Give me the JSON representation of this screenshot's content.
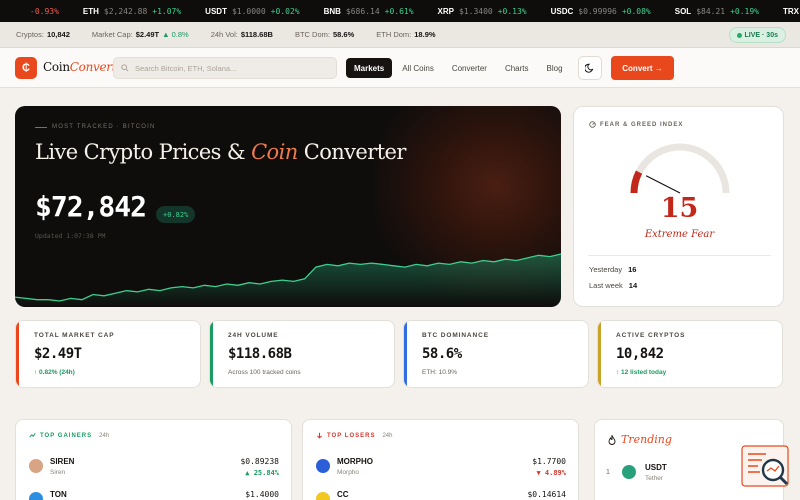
{
  "ticker": [
    {
      "sym": "",
      "price": "",
      "change": "-0.93%",
      "neg": true
    },
    {
      "sym": "ETH",
      "price": "$2,242.88",
      "change": "+1.07%",
      "neg": false
    },
    {
      "sym": "USDT",
      "price": "$1.0000",
      "change": "+0.02%",
      "neg": false
    },
    {
      "sym": "BNB",
      "price": "$686.14",
      "change": "+0.61%",
      "neg": false
    },
    {
      "sym": "XRP",
      "price": "$1.3400",
      "change": "+0.13%",
      "neg": false
    },
    {
      "sym": "USDC",
      "price": "$0.99996",
      "change": "+0.08%",
      "neg": false
    },
    {
      "sym": "SOL",
      "price": "$84.21",
      "change": "+0.19%",
      "neg": false
    },
    {
      "sym": "TRX",
      "price": "$0.31825",
      "change": "+0.28%",
      "neg": false
    }
  ],
  "stats": {
    "cryptos_label": "Cryptos:",
    "cryptos_value": "10,842",
    "mcap_label": "Market Cap:",
    "mcap_value": "$2.49T",
    "mcap_change": "▲ 0.8%",
    "vol_label": "24h Vol:",
    "vol_value": "$118.68B",
    "btc_label": "BTC Dom:",
    "btc_value": "58.6%",
    "eth_label": "ETH Dom:",
    "eth_value": "18.9%",
    "live": "LIVE · 30s"
  },
  "header": {
    "logo_mark": "₵",
    "logo_a": "Coin",
    "logo_b": "Converter",
    "search_placeholder": "Search Bitcoin, ETH, Solana...",
    "nav": [
      "Markets",
      "All Coins",
      "Converter",
      "Charts",
      "Blog"
    ],
    "convert_label": "Convert →"
  },
  "hero": {
    "kicker": "MOST TRACKED · BITCOIN",
    "title_a": "Live Crypto Prices & ",
    "title_em": "Coin",
    "title_b": " Converter",
    "price": "$72,842",
    "change": "+0.82%",
    "updated": "Updated 1:07:38 PM",
    "sparkline": [
      10,
      9,
      8,
      8,
      7,
      9,
      8,
      12,
      11,
      13,
      15,
      14,
      16,
      15,
      17,
      18,
      17,
      19,
      18,
      20,
      19,
      21,
      20,
      22,
      23,
      22,
      24,
      33,
      35,
      34,
      36,
      35,
      36,
      35,
      34,
      33,
      35,
      34,
      36,
      35,
      37,
      36,
      38,
      37,
      39,
      38,
      40,
      42,
      41,
      43
    ]
  },
  "fear_greed": {
    "label": "FEAR & GREED INDEX",
    "value": 15,
    "value_text": "15",
    "classification": "Extreme Fear",
    "yesterday_label": "Yesterday",
    "yesterday_value": "16",
    "lastweek_label": "Last week",
    "lastweek_value": "14",
    "colors": {
      "fear": "#c2271a",
      "track": "#e9e6e1"
    }
  },
  "metrics": [
    {
      "label": "TOTAL MARKET CAP",
      "value": "$2.49T",
      "sub": "↑ 0.82% (24h)",
      "up": true,
      "accent": "#e8481c"
    },
    {
      "label": "24H VOLUME",
      "value": "$118.68B",
      "sub": "Across 100 tracked coins",
      "up": false,
      "accent": "#1a9b62"
    },
    {
      "label": "BTC DOMINANCE",
      "value": "58.6%",
      "sub": "ETH: 10.9%",
      "up": false,
      "accent": "#2f6de0"
    },
    {
      "label": "ACTIVE CRYPTOS",
      "value": "10,842",
      "sub": "↑ 12 listed today",
      "up": true,
      "accent": "#c9a227"
    }
  ],
  "gainers": {
    "label": "TOP GAINERS",
    "period": "24h",
    "rows": [
      {
        "name": "SIREN",
        "sub": "Siren",
        "price": "$0.89238",
        "change": "▲ 25.84%",
        "color": "#d9a483"
      },
      {
        "name": "TON",
        "sub": "",
        "price": "$1.4000",
        "change": "",
        "color": "#2a8fe0"
      }
    ]
  },
  "losers": {
    "label": "TOP LOSERS",
    "period": "24h",
    "rows": [
      {
        "name": "MORPHO",
        "sub": "Morpho",
        "price": "$1.7700",
        "change": "▼ 4.89%",
        "color": "#2b5fd9"
      },
      {
        "name": "CC",
        "sub": "",
        "price": "$0.14614",
        "change": "",
        "color": "#f2c81d"
      }
    ]
  },
  "trending": {
    "title": "Trending",
    "rows": [
      {
        "rank": "1",
        "name": "USDT",
        "sub": "Tether",
        "color": "#26a17b"
      }
    ]
  }
}
